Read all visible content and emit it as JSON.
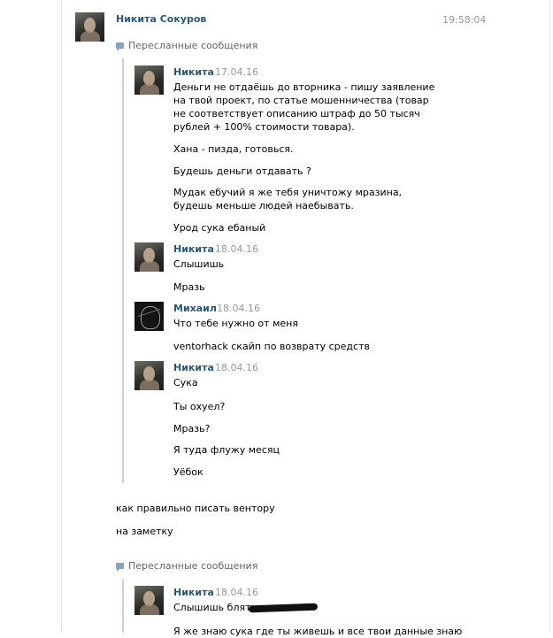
{
  "header": {
    "author": "Никита Сокуров",
    "time": "19:58:04"
  },
  "forward_label": "Пересланные сообщения",
  "forward1": {
    "messages": [
      {
        "author": "Никита",
        "date": "17.04.16",
        "lines": [
          "Деньги не отдаёшь до вторника - пишу заявление на твой проект, по статье мошенничества (товар не соответствует описанию штраф до 50 тысяч рублей + 100% стоимости товара).",
          "Хана - пизда, готовься.",
          "Будешь деньги отдавать ?",
          "Мудак ебучий я же тебя уничтожу мразина, будешь меньше людей наебывать.",
          "Урод сука ебаный"
        ]
      },
      {
        "author": "Никита",
        "date": "18.04.16",
        "lines": [
          "Слышишь",
          "Мразь"
        ]
      },
      {
        "author": "Михаил",
        "date": "18.04.16",
        "lines": [
          "Что тебе нужно от меня",
          "ventorhack скайп по возврату средств"
        ]
      },
      {
        "author": "Никита",
        "date": "18.04.16",
        "lines": [
          "Сука",
          "Ты охуел?",
          "Мразь?",
          "Я туда флужу месяц",
          "Уёбок"
        ]
      }
    ]
  },
  "own_lines": [
    "как правильно писать вентору",
    "на заметку"
  ],
  "forward2": {
    "messages": [
      {
        "author": "Никита",
        "date": "18.04.16",
        "lines": [
          "Слышишь блять",
          "Я же знаю сука где ты живешь и все твои данные знаю"
        ]
      }
    ]
  },
  "colors": {
    "author_link": "#2b587a",
    "date_gray": "#999999",
    "forward_bar": "#c5d3e2"
  }
}
